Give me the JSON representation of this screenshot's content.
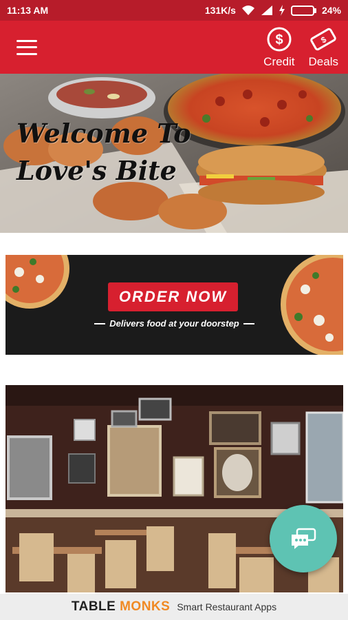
{
  "status_bar": {
    "time": "11:13 AM",
    "net_speed": "131K/s",
    "battery": "24%",
    "battery_level": 0.24
  },
  "app_bar": {
    "menu_icon": "hamburger-menu-icon",
    "actions": [
      {
        "label": "Credit",
        "icon": "dollar-circle-icon"
      },
      {
        "label": "Deals",
        "icon": "ticket-icon"
      }
    ]
  },
  "hero": {
    "line1": "Welcome To",
    "line2": "Love's Bite"
  },
  "order_banner": {
    "button": "ORDER NOW",
    "tagline": "Delivers food at your doorstep"
  },
  "fab": {
    "icon": "chat-bubbles-icon"
  },
  "footer": {
    "brand_part1": "TABLE",
    "brand_part2": "MONKS",
    "tagline": "Smart Restaurant Apps"
  },
  "colors": {
    "primary": "#d7202f",
    "status_bar": "#b71c2a",
    "fab": "#5ec3b3",
    "brand_accent": "#f08a24"
  }
}
